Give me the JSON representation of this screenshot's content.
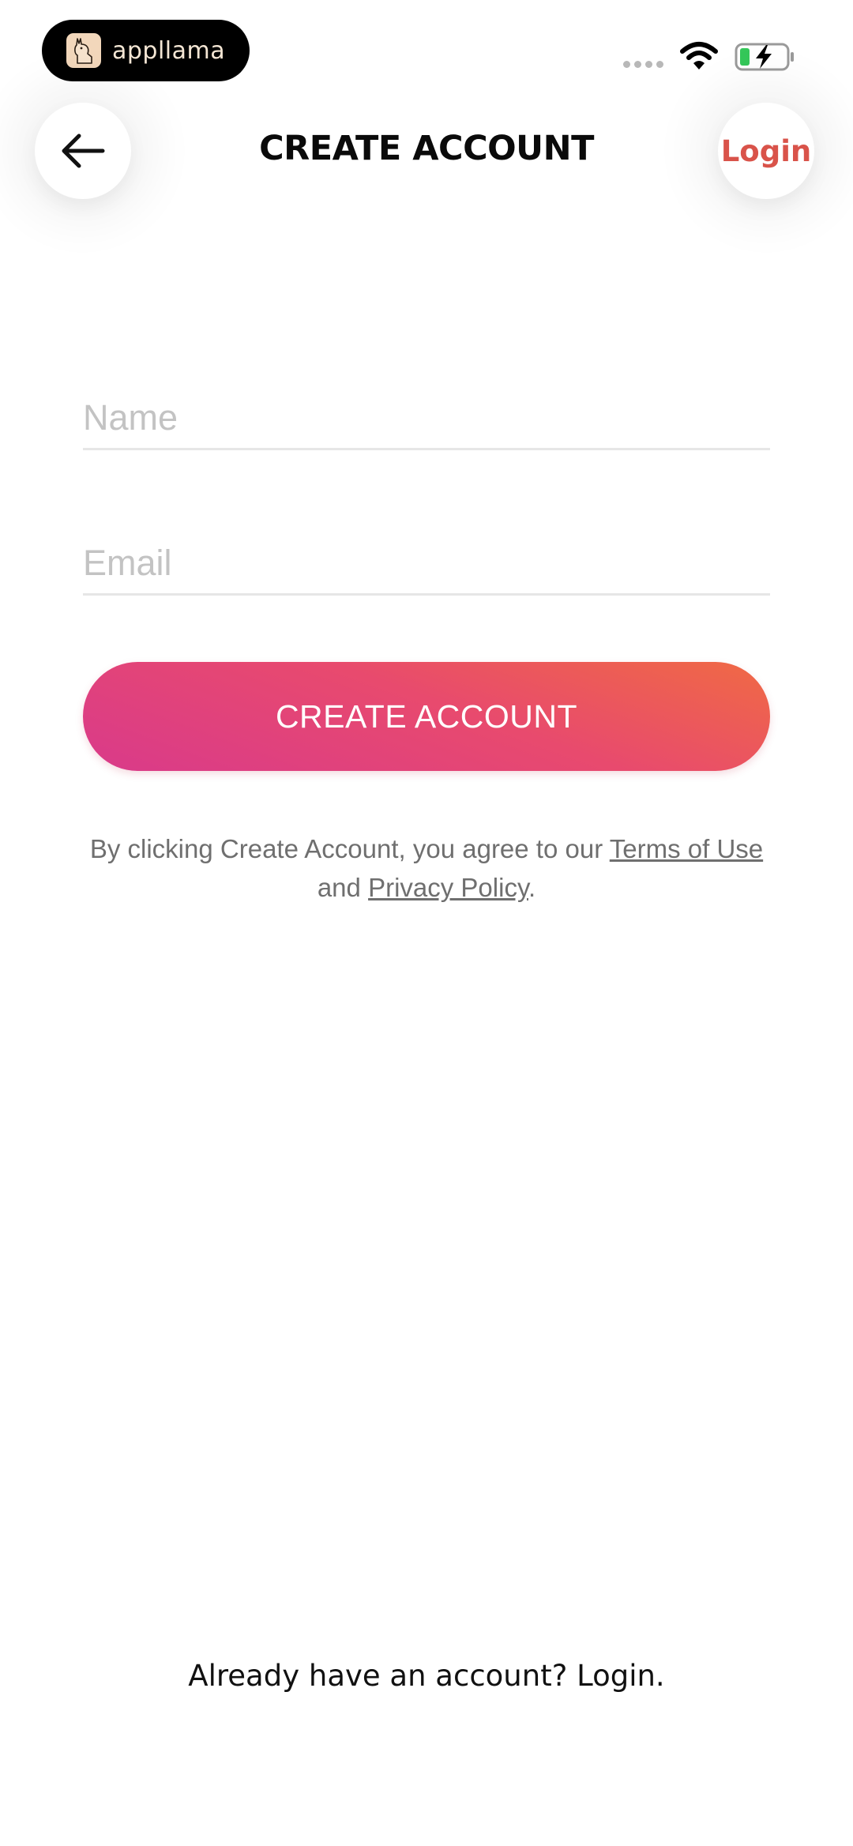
{
  "status_bar": {
    "brand_name": "appllama",
    "brand_icon": "llama-icon",
    "wifi_icon": "wifi-icon",
    "battery_icon": "battery-charging-icon",
    "battery_fill_color": "#34c759"
  },
  "header": {
    "back_icon": "arrow-left-icon",
    "title": "CREATE ACCOUNT",
    "login_label": "Login",
    "login_color": "#d9534a"
  },
  "form": {
    "name_placeholder": "Name",
    "name_value": "",
    "email_placeholder": "Email",
    "email_value": "",
    "submit_label": "CREATE ACCOUNT",
    "submit_gradient": [
      "#f06a44",
      "#e84a6e",
      "#d93a8a"
    ]
  },
  "legal": {
    "prefix": "By clicking Create Account, you agree to our ",
    "terms_link": "Terms of Use",
    "middle": " and ",
    "privacy_link": "Privacy Policy",
    "suffix": "."
  },
  "footer": {
    "prompt": "Already have an account? ",
    "login_link": "Login."
  }
}
